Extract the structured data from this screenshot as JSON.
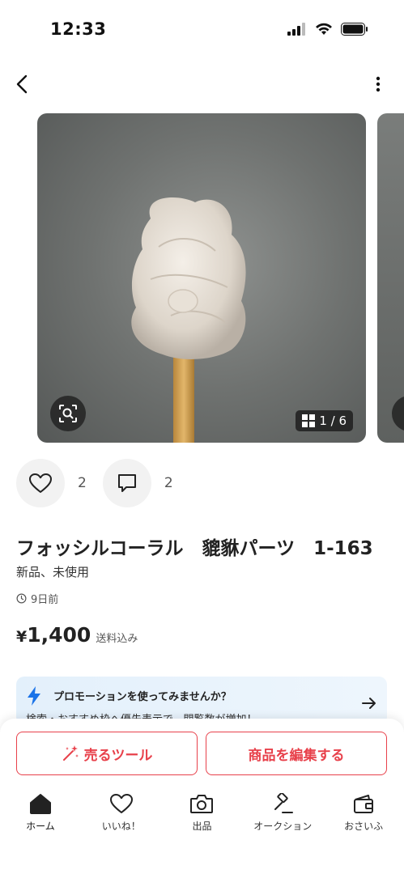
{
  "status_bar": {
    "time": "12:33"
  },
  "gallery": {
    "counter": "1 / 6"
  },
  "actions": {
    "likes": "2",
    "comments": "2"
  },
  "item": {
    "title": "フォッシルコーラル　貔貅パーツ　1-163",
    "condition": "新品、未使用",
    "posted": "9日前",
    "price": "1,400",
    "currency": "¥",
    "shipping": "送料込み"
  },
  "promo": {
    "title": "プロモーションを使ってみませんか？",
    "subtitle": "検索・おすすめ枠へ優先表示で、閲覧数が増加！"
  },
  "buttons": {
    "sell_tool": "売るツール",
    "edit_item": "商品を編集する"
  },
  "tabs": [
    {
      "label": "ホーム",
      "icon": "home-icon"
    },
    {
      "label": "いいね！",
      "icon": "heart-icon"
    },
    {
      "label": "出品",
      "icon": "camera-icon"
    },
    {
      "label": "オークション",
      "icon": "gavel-icon"
    },
    {
      "label": "おさいふ",
      "icon": "wallet-icon"
    }
  ],
  "colors": {
    "accent": "#e8414b",
    "promo_icon": "#1a73e8"
  }
}
